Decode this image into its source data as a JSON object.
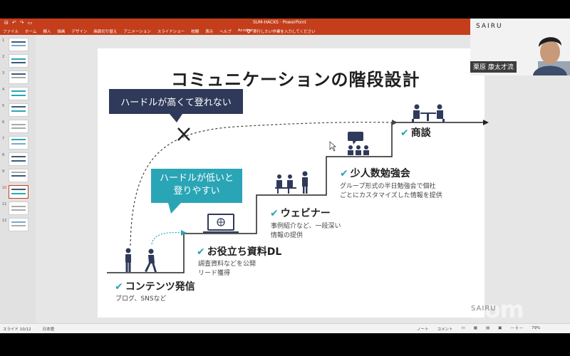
{
  "window": {
    "doc_title": "SUM-HACKS  ·  PowerPoint",
    "quick_access": [
      "⊟",
      "↶",
      "↷",
      "▭"
    ]
  },
  "ribbon": {
    "tabs": [
      "ファイル",
      "ホーム",
      "挿入",
      "描画",
      "デザイン",
      "画面切り替え",
      "アニメーション",
      "スライドショー",
      "校閲",
      "表示",
      "ヘルプ",
      "Acrobat"
    ],
    "search_placeholder": "実行したい作業を入力してください"
  },
  "thumbnails": [
    {
      "num": "1"
    },
    {
      "num": "2"
    },
    {
      "num": "3"
    },
    {
      "num": "4"
    },
    {
      "num": "5"
    },
    {
      "num": "6"
    },
    {
      "num": "7"
    },
    {
      "num": "8"
    },
    {
      "num": "9"
    },
    {
      "num": "10",
      "active": true
    },
    {
      "num": "11"
    },
    {
      "num": "12"
    }
  ],
  "slide": {
    "title": "コミュニケーションの階段設計",
    "bubble_hard": "ハードルが高くて登れない",
    "bubble_easy_1": "ハードルが低いと",
    "bubble_easy_2": "登りやすい",
    "check": "✔",
    "steps": [
      {
        "title": "コンテンツ発信",
        "desc": [
          "ブログ、SNSなど"
        ]
      },
      {
        "title": "お役立ち資料DL",
        "desc": [
          "調査資料などを公開",
          "リード獲得"
        ]
      },
      {
        "title": "ウェビナー",
        "desc": [
          "事例紹介など、一段深い",
          "情報の提供"
        ]
      },
      {
        "title": "少人数勉強会",
        "desc": [
          "グループ形式の半日勉強会で個社",
          "ごとにカスタマイズした情報を提供"
        ]
      },
      {
        "title": "商談",
        "desc": []
      }
    ]
  },
  "statusbar": {
    "slide_info": "スライド 10/12",
    "language": "日本語",
    "notes": "ノート",
    "comments": "コメント",
    "zoom": "79%"
  },
  "webcam": {
    "logo": "SAIRU",
    "name": "栗原 康太才流"
  },
  "watermark": {
    "zoom": "zoom",
    "brand": "SAIRU"
  },
  "colors": {
    "ribbon": "#c43e1c",
    "navy": "#2f3a5a",
    "teal": "#2aa5b6"
  }
}
